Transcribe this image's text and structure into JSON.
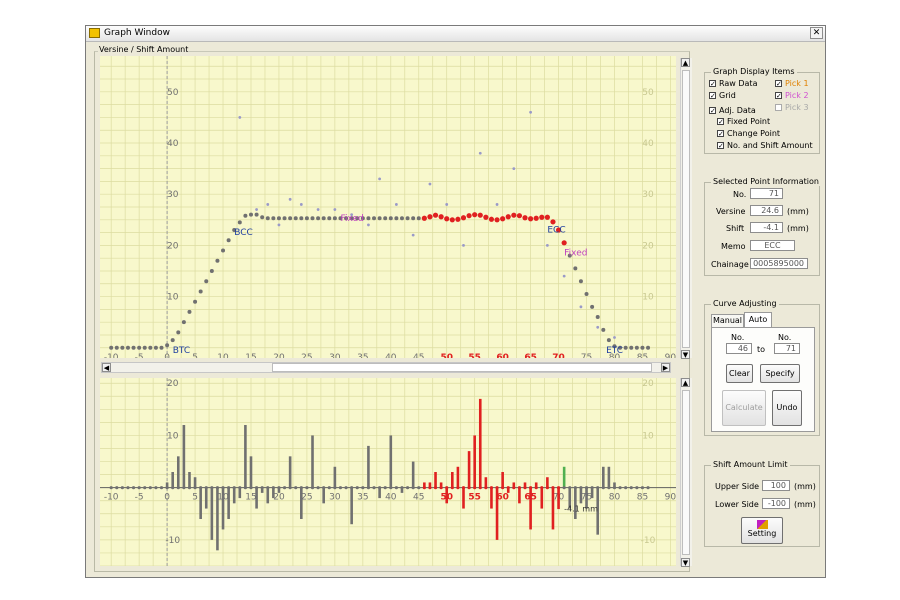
{
  "window": {
    "title": "Graph Window",
    "close_label": "✕"
  },
  "graph": {
    "caption": "Versine / Shift Amount"
  },
  "display_items": {
    "title": "Graph Display Items",
    "raw_data": "Raw Data",
    "grid": "Grid",
    "adj_data": "Adj. Data",
    "fixed_point": "Fixed Point",
    "change_point": "Change Point",
    "no_shift": "No. and Shift Amount",
    "pick1": "Pick 1",
    "pick2": "Pick 2",
    "pick3": "Pick 3",
    "check": "✓"
  },
  "selected_point": {
    "title": "Selected Point Information",
    "no_label": "No.",
    "no_value": "71",
    "versine_label": "Versine",
    "versine_value": "24.6",
    "versine_unit": "(mm)",
    "shift_label": "Shift",
    "shift_value": "-4.1",
    "shift_unit": "(mm)",
    "memo_label": "Memo",
    "memo_value": "ECC",
    "chainage_label": "Chainage",
    "chainage_value": "0005895000"
  },
  "curve_adjusting": {
    "title": "Curve Adjusting",
    "tab_manual": "Manual",
    "tab_auto": "Auto",
    "no_label_1": "No.",
    "no_label_2": "No.",
    "from_value": "46",
    "to_label": "to",
    "to_value": "71",
    "clear": "Clear",
    "specify": "Specify",
    "calculate": "Calculate",
    "undo": "Undo"
  },
  "shift_limit": {
    "title": "Shift Amount Limit",
    "upper_label": "Upper Side",
    "upper_value": "100",
    "upper_unit": "(mm)",
    "lower_label": "Lower Side",
    "lower_value": "-100",
    "lower_unit": "(mm)",
    "setting": "Setting"
  },
  "chart_data": [
    {
      "type": "scatter",
      "xlim": [
        -12,
        91
      ],
      "ylim": [
        -2,
        57
      ],
      "x_ticks": [
        -10,
        -5,
        0,
        5,
        10,
        15,
        20,
        25,
        30,
        35,
        40,
        45,
        50,
        55,
        60,
        65,
        70,
        75,
        80,
        85,
        90
      ],
      "x_ticks_red": [
        50,
        55,
        60,
        65,
        70
      ],
      "y_ticks": [
        10,
        20,
        30,
        40,
        50
      ],
      "grid": true,
      "annotations": [
        {
          "text": "BCC",
          "x": 12,
          "y": 22,
          "color": "#1f3fa0"
        },
        {
          "text": "BTC",
          "x": 1,
          "y": -1,
          "color": "#1f3fa0"
        },
        {
          "text": "ECC",
          "x": 68,
          "y": 22.5,
          "color": "#1f3fa0"
        },
        {
          "text": "ETC",
          "x": 78.5,
          "y": -1,
          "color": "#1f3fa0"
        },
        {
          "text": "Fixed",
          "x": 31,
          "y": 24.8,
          "color": "#c040c0"
        },
        {
          "text": "Fixed",
          "x": 71,
          "y": 18,
          "color": "#c040c0"
        }
      ],
      "adj_series": {
        "x": [
          -10,
          -9,
          -8,
          -7,
          -6,
          -5,
          -4,
          -3,
          -2,
          -1,
          0,
          1,
          2,
          3,
          4,
          5,
          6,
          7,
          8,
          9,
          10,
          11,
          12,
          13,
          14,
          15,
          16,
          17,
          18,
          19,
          20,
          21,
          22,
          23,
          24,
          25,
          26,
          27,
          28,
          29,
          30,
          31,
          32,
          33,
          34,
          35,
          36,
          37,
          38,
          39,
          40,
          41,
          42,
          43,
          44,
          45,
          46,
          47,
          48,
          49,
          50,
          51,
          52,
          53,
          54,
          55,
          56,
          57,
          58,
          59,
          60,
          61,
          62,
          63,
          64,
          65,
          66,
          67,
          68,
          69,
          70,
          71,
          72,
          73,
          74,
          75,
          76,
          77,
          78,
          79,
          80,
          81,
          82,
          83,
          84,
          85,
          86
        ],
        "y": [
          0,
          0,
          0,
          0,
          0,
          0,
          0,
          0,
          0,
          0,
          0.5,
          1.5,
          3,
          5,
          7,
          9,
          11,
          13,
          15,
          17,
          19,
          21,
          23,
          24.5,
          25.8,
          26,
          26,
          25.5,
          25.3,
          25.3,
          25.3,
          25.3,
          25.3,
          25.3,
          25.3,
          25.3,
          25.3,
          25.3,
          25.3,
          25.3,
          25.3,
          25.3,
          25.3,
          25.3,
          25.3,
          25.3,
          25.3,
          25.3,
          25.3,
          25.3,
          25.3,
          25.3,
          25.3,
          25.3,
          25.3,
          25.3,
          25.3,
          25.6,
          25.9,
          25.6,
          25.2,
          25,
          25.1,
          25.4,
          25.8,
          26,
          25.9,
          25.5,
          25.1,
          25,
          25.2,
          25.6,
          25.9,
          25.8,
          25.4,
          25.2,
          25.3,
          25.5,
          25.5,
          24.6,
          23,
          20.5,
          18,
          15.5,
          13,
          10.5,
          8,
          6,
          3.5,
          1.5,
          0.3,
          0,
          0,
          0,
          0,
          0,
          0
        ],
        "color": "#707070",
        "highlight_color": "#e02020",
        "highlight_range": [
          46,
          71
        ]
      },
      "raw_series": {
        "x": [
          13,
          16,
          18,
          20,
          22,
          24,
          27,
          30,
          33,
          36,
          38,
          41,
          44,
          47,
          50,
          53,
          56,
          59,
          62,
          65,
          68,
          71,
          74,
          77,
          80
        ],
        "y": [
          45,
          27,
          28,
          24,
          29,
          28,
          27,
          27,
          26,
          24,
          33,
          28,
          22,
          32,
          28,
          20,
          38,
          28,
          35,
          46,
          20,
          14,
          8,
          4,
          2
        ],
        "color": "#9a9ac8"
      }
    },
    {
      "type": "bar",
      "xlim": [
        -12,
        91
      ],
      "ylim": [
        -15,
        21
      ],
      "x_ticks": [
        -10,
        -5,
        0,
        5,
        10,
        15,
        20,
        25,
        30,
        35,
        40,
        45,
        50,
        55,
        60,
        65,
        70,
        75,
        80,
        85,
        90
      ],
      "x_ticks_red": [
        50,
        55,
        60,
        65
      ],
      "y_ticks": [
        -10,
        10,
        20
      ],
      "grid": true,
      "annotation": {
        "text": "-4.1 mm",
        "x": 71,
        "y": -4.6
      },
      "bars": {
        "x": [
          0,
          1,
          2,
          3,
          4,
          5,
          6,
          7,
          8,
          9,
          10,
          11,
          12,
          13,
          14,
          15,
          16,
          17,
          18,
          19,
          20,
          22,
          24,
          26,
          28,
          30,
          33,
          36,
          38,
          40,
          42,
          44,
          46,
          47,
          48,
          49,
          50,
          51,
          52,
          53,
          54,
          55,
          56,
          57,
          58,
          59,
          60,
          61,
          62,
          63,
          64,
          65,
          66,
          67,
          68,
          69,
          70,
          71,
          72,
          73,
          74,
          75,
          76,
          77,
          78,
          79,
          80
        ],
        "y": [
          1,
          3,
          6,
          12,
          3,
          2,
          -6,
          -4,
          -10,
          -12,
          -8,
          -6,
          -3,
          -2,
          12,
          6,
          -4,
          -1,
          -3,
          -2,
          -1,
          6,
          -6,
          10,
          -3,
          4,
          -7,
          8,
          -2,
          10,
          -1,
          5,
          1,
          1,
          3,
          1,
          -3,
          3,
          4,
          -4,
          7,
          10,
          17,
          2,
          -4,
          -10,
          3,
          -1,
          1,
          -3,
          1,
          -8,
          1,
          -4,
          2,
          -8,
          -4.1,
          4,
          -4,
          -6,
          -3,
          -4,
          -2,
          -9,
          4,
          4,
          1
        ],
        "color": "#707070",
        "highlight_color": "#e02020",
        "highlight_range": [
          46,
          70
        ],
        "selected_x": 71,
        "selected_color": "#50b050"
      }
    }
  ]
}
